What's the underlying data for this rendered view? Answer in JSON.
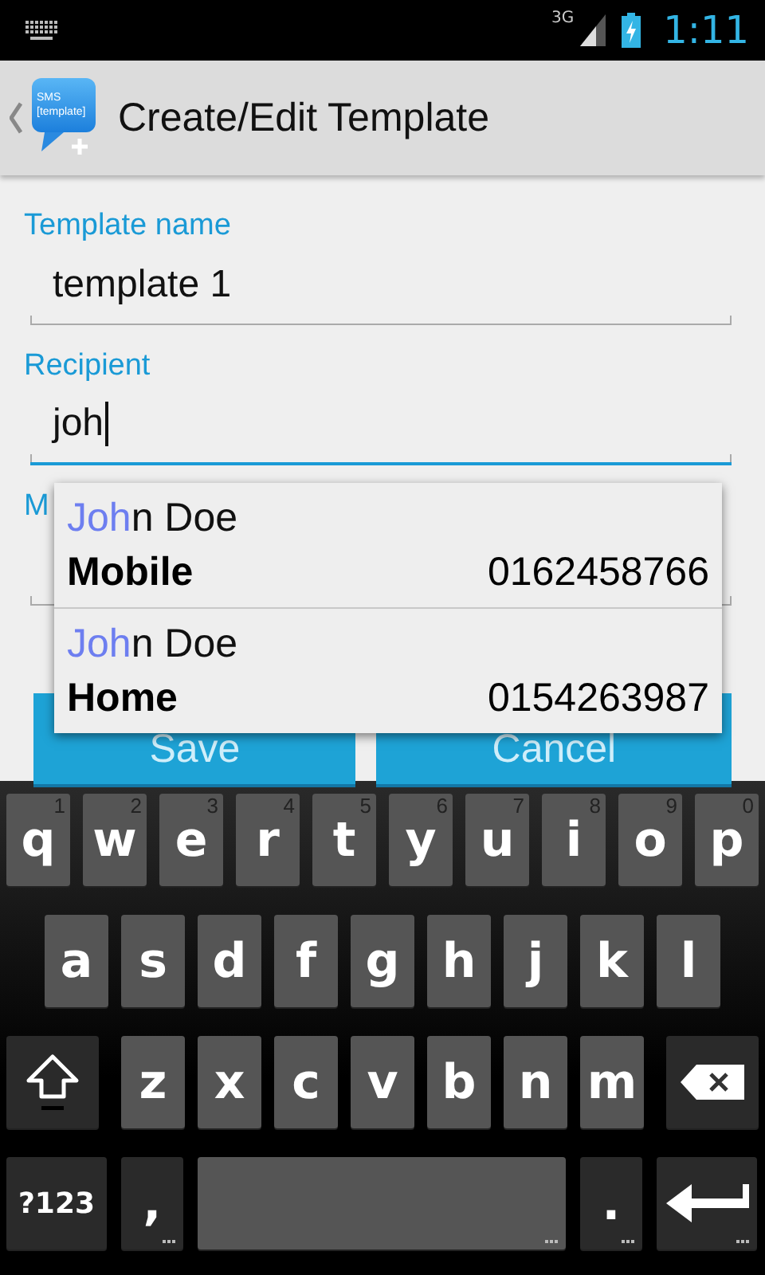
{
  "status_bar": {
    "network": "3G",
    "time": "1:11"
  },
  "action_bar": {
    "icon_text": [
      "SMS",
      "[template]"
    ],
    "title": "Create/Edit Template"
  },
  "fields": [
    {
      "label": "Template name",
      "value": "template 1",
      "focused": false
    },
    {
      "label": "Recipient",
      "value": "joh",
      "focused": true
    },
    {
      "label": "M",
      "focused": false
    }
  ],
  "suggestions": [
    {
      "match": "Joh",
      "rest": "n Doe",
      "type": "Mobile",
      "number": "0162458766"
    },
    {
      "match": "Joh",
      "rest": "n Doe",
      "type": "Home",
      "number": "0154263987"
    }
  ],
  "buttons": [
    "Save",
    "Cancel"
  ],
  "keyboard": {
    "rows": [
      {
        "keys": [
          {
            "kind": "letter",
            "label": "q",
            "hint": "1"
          },
          {
            "kind": "letter",
            "label": "w",
            "hint": "2"
          },
          {
            "kind": "letter",
            "label": "e",
            "hint": "3"
          },
          {
            "kind": "letter",
            "label": "r",
            "hint": "4"
          },
          {
            "kind": "letter",
            "label": "t",
            "hint": "5"
          },
          {
            "kind": "letter",
            "label": "y",
            "hint": "6"
          },
          {
            "kind": "letter",
            "label": "u",
            "hint": "7"
          },
          {
            "kind": "letter",
            "label": "i",
            "hint": "8"
          },
          {
            "kind": "letter",
            "label": "o",
            "hint": "9"
          },
          {
            "kind": "letter",
            "label": "p",
            "hint": "0"
          }
        ]
      },
      {
        "keys": [
          {
            "kind": "letter",
            "label": "a"
          },
          {
            "kind": "letter",
            "label": "s"
          },
          {
            "kind": "letter",
            "label": "d"
          },
          {
            "kind": "letter",
            "label": "f"
          },
          {
            "kind": "letter",
            "label": "g"
          },
          {
            "kind": "letter",
            "label": "h"
          },
          {
            "kind": "letter",
            "label": "j"
          },
          {
            "kind": "letter",
            "label": "k"
          },
          {
            "kind": "letter",
            "label": "l"
          }
        ]
      },
      {
        "keys": [
          {
            "kind": "shift"
          },
          {
            "kind": "letter",
            "label": "z"
          },
          {
            "kind": "letter",
            "label": "x"
          },
          {
            "kind": "letter",
            "label": "c"
          },
          {
            "kind": "letter",
            "label": "v"
          },
          {
            "kind": "letter",
            "label": "b"
          },
          {
            "kind": "letter",
            "label": "n"
          },
          {
            "kind": "letter",
            "label": "m"
          },
          {
            "kind": "delete"
          }
        ]
      },
      {
        "keys": [
          {
            "kind": "symbols",
            "label": "?123"
          },
          {
            "kind": "comma",
            "label": ",",
            "more": true
          },
          {
            "kind": "space",
            "more": true
          },
          {
            "kind": "period",
            "label": ".",
            "more": true
          },
          {
            "kind": "enter",
            "more": true
          }
        ]
      }
    ]
  }
}
